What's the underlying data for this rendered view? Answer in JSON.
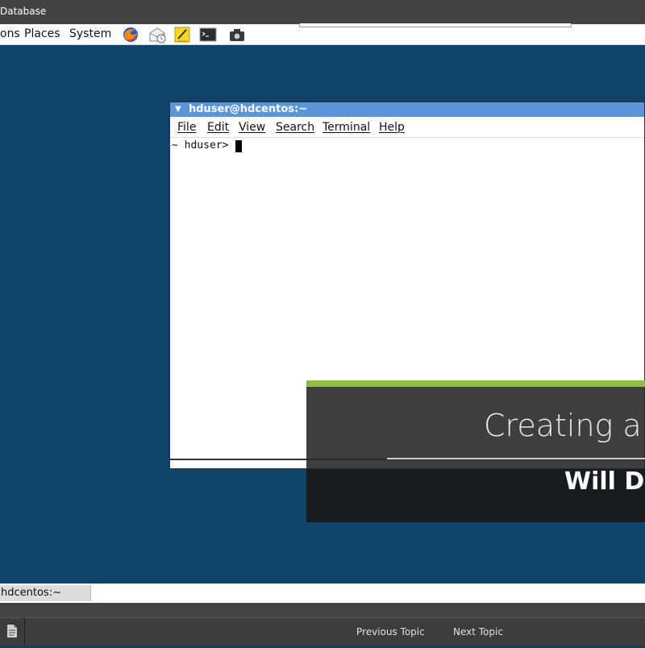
{
  "window": {
    "title": "Database"
  },
  "panel": {
    "menus": [
      "ons",
      "Places",
      "System"
    ],
    "launchers": [
      "firefox-icon",
      "mail-icon",
      "notes-icon",
      "terminal-icon",
      "screenshot-icon"
    ]
  },
  "terminal": {
    "title": "hduser@hdcentos:~",
    "menu": [
      "File",
      "Edit",
      "View",
      "Search",
      "Terminal",
      "Help"
    ],
    "prompt": "~ hduser>"
  },
  "overlay": {
    "title": "Creating a D",
    "author": "Will Da",
    "accent_color": "#8dbf3c"
  },
  "taskbar": {
    "item": "hdcentos:~"
  },
  "nav": {
    "previous": "Previous Topic",
    "next": "Next Topic"
  },
  "colors": {
    "desktop": "#0f4468",
    "terminal_title": "#5b95d8",
    "titlebar": "#434343"
  }
}
